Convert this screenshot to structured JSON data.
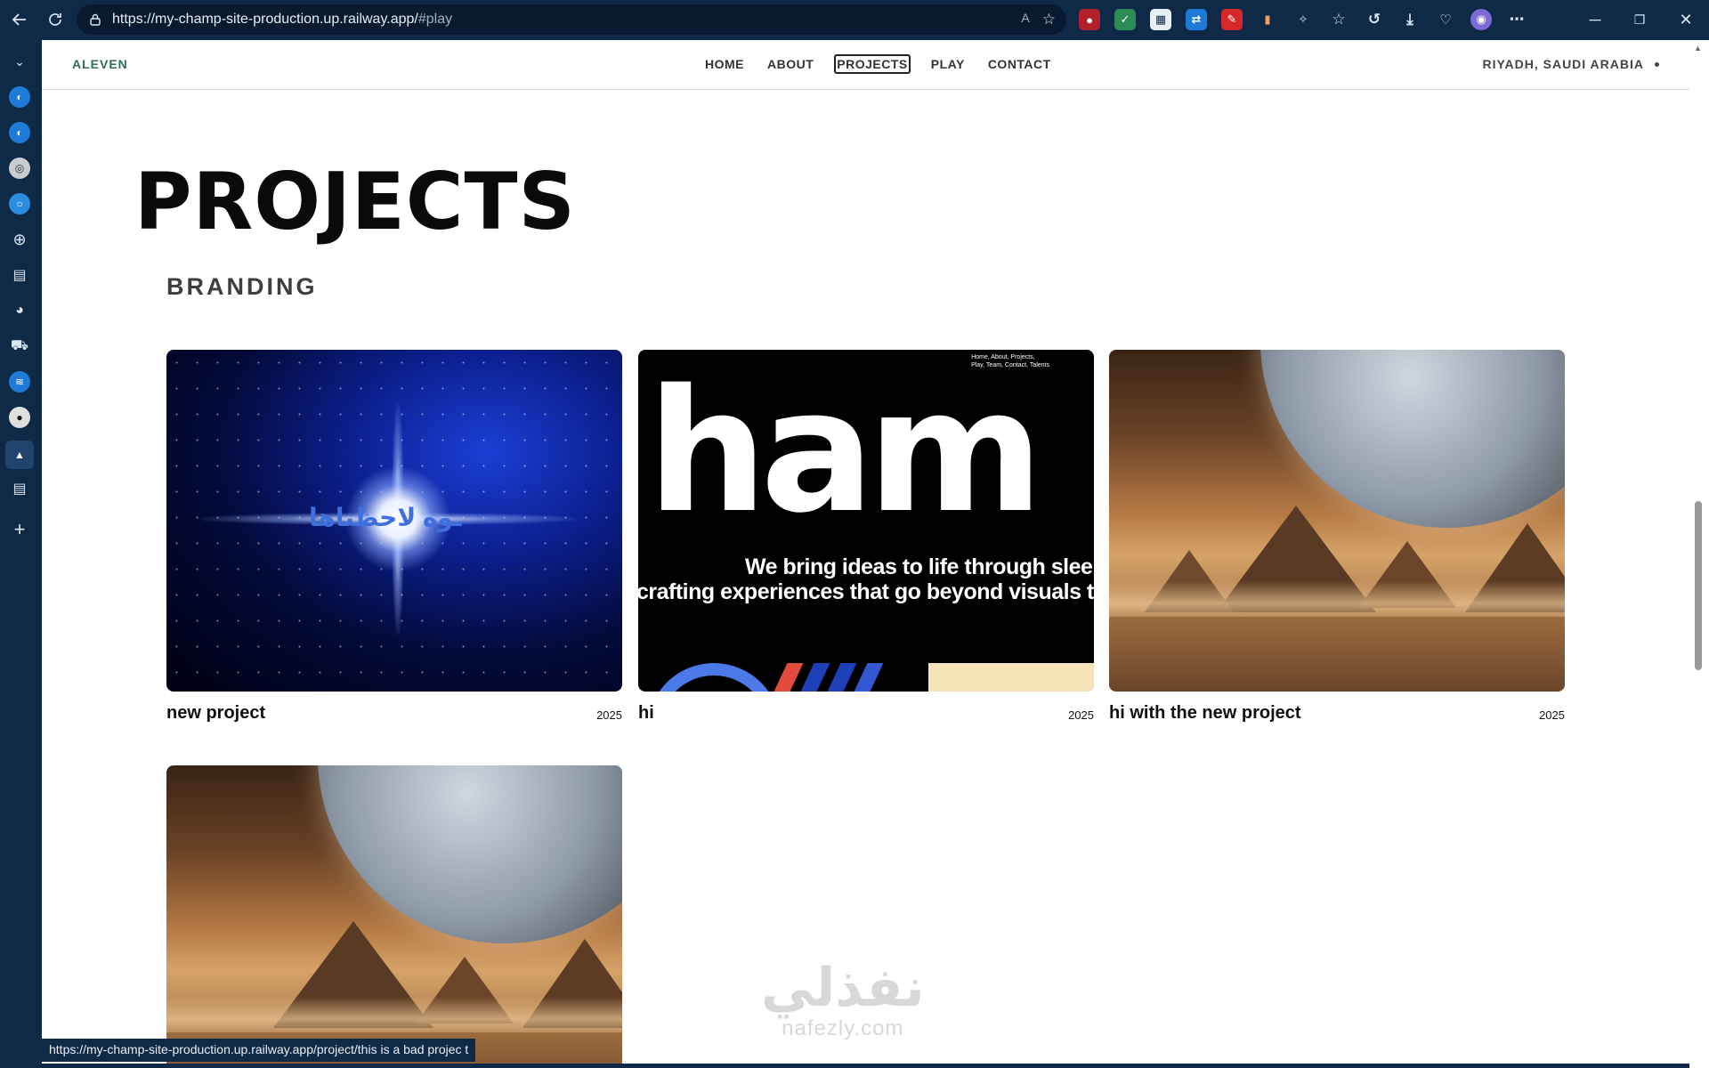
{
  "browser": {
    "url_host": "https://my-champ-site-production.up.railway.app/",
    "url_rest": "#play"
  },
  "site": {
    "logo": "ALEVEN",
    "nav": [
      "HOME",
      "ABOUT",
      "PROJECTS",
      "PLAY",
      "CONTACT"
    ],
    "active_nav": "PROJECTS",
    "location": "RIYADH, SAUDI ARABIA"
  },
  "page": {
    "title": "PROJECTS",
    "section": "BRANDING"
  },
  "projects": [
    {
      "name": "new project",
      "year": "2025",
      "thumb_text": "ـوه لاحظناها"
    },
    {
      "name": "hi",
      "year": "2025",
      "thumb_big": "ham",
      "thumb_menu_1": "Home, About, Projects,",
      "thumb_menu_2": "Play, Team, Contact, Talents",
      "thumb_line_1": "We bring ideas to life through sleek",
      "thumb_line_2": "crafting experiences that go beyond visuals to"
    },
    {
      "name": "hi with the new project",
      "year": "2025"
    },
    {
      "name": "",
      "year": ""
    }
  ],
  "status_bar": "https://my-champ-site-production.up.railway.app/project/this is a bad projec t",
  "watermark": {
    "arabic": "نفذلي",
    "latin": "nafezly.com"
  },
  "colors": {
    "chrome": "#0f2a47",
    "logo": "#2f6b5c",
    "text": "#0a0a0a"
  },
  "icons": [
    "back-icon",
    "refresh-icon",
    "lock-icon",
    "read-aloud-icon",
    "star-icon",
    "favorites-icon",
    "history-icon",
    "download-icon",
    "health-icon",
    "more-icon",
    "minimize-icon",
    "restore-icon",
    "close-icon"
  ]
}
